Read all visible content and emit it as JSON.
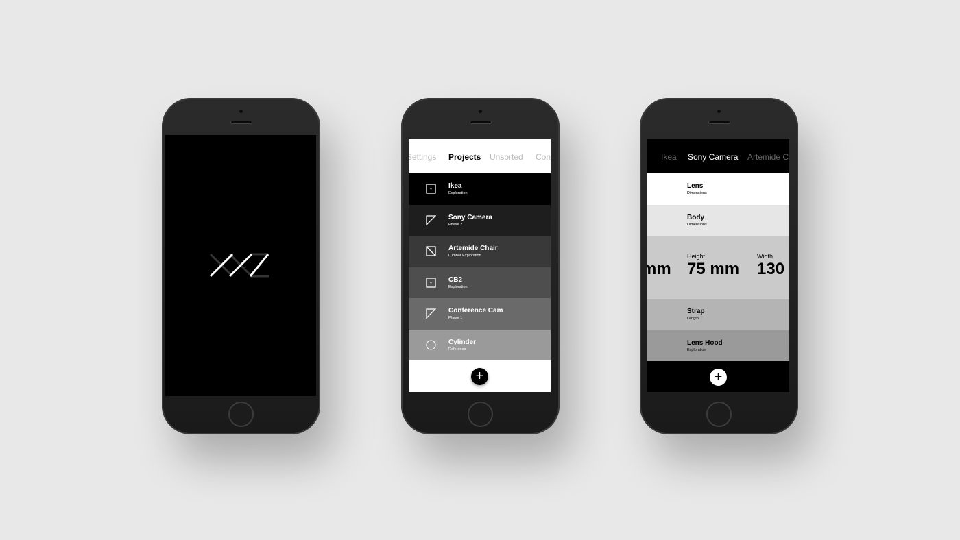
{
  "splash": {
    "logo": "XYZ"
  },
  "projects": {
    "tabs": [
      "Settings",
      "Projects",
      "Unsorted",
      "Con"
    ],
    "active_tab": "Projects",
    "items": [
      {
        "title": "Ikea",
        "subtitle": "Exploration",
        "icon": "square-dot-icon",
        "color": "#000000"
      },
      {
        "title": "Sony Camera",
        "subtitle": "Phase 2",
        "icon": "triangle-icon",
        "color": "#1e1e1e"
      },
      {
        "title": "Artemide Chair",
        "subtitle": "Lumbar Exploration",
        "icon": "square-diagonal-icon",
        "color": "#393939"
      },
      {
        "title": "CB2",
        "subtitle": "Exploration",
        "icon": "square-dot-icon",
        "color": "#4e4e4e"
      },
      {
        "title": "Conference Cam",
        "subtitle": "Phase 1",
        "icon": "triangle-icon",
        "color": "#6a6a6a"
      },
      {
        "title": "Cylinder",
        "subtitle": "Reference",
        "icon": "circle-icon",
        "color": "#9a9a9a"
      }
    ],
    "add_label": "+"
  },
  "detail": {
    "tabs": [
      "Ikea",
      "Sony Camera",
      "Artemide Cl"
    ],
    "active_tab": "Sony Camera",
    "items": [
      {
        "title": "Lens",
        "subtitle": "Dimensions",
        "color": "#ffffff"
      },
      {
        "title": "Body",
        "subtitle": "Dimensions",
        "color": "#e6e6e6"
      }
    ],
    "measure": {
      "prev_value": "mm",
      "label": "Height",
      "value": "75 mm",
      "next_label": "Width",
      "next_value": "130",
      "color": "#cacaca"
    },
    "items_after": [
      {
        "title": "Strap",
        "subtitle": "Length",
        "color": "#b4b4b4"
      },
      {
        "title": "Lens Hood",
        "subtitle": "Exploration",
        "color": "#9a9a9a"
      }
    ],
    "add_label": "+"
  }
}
